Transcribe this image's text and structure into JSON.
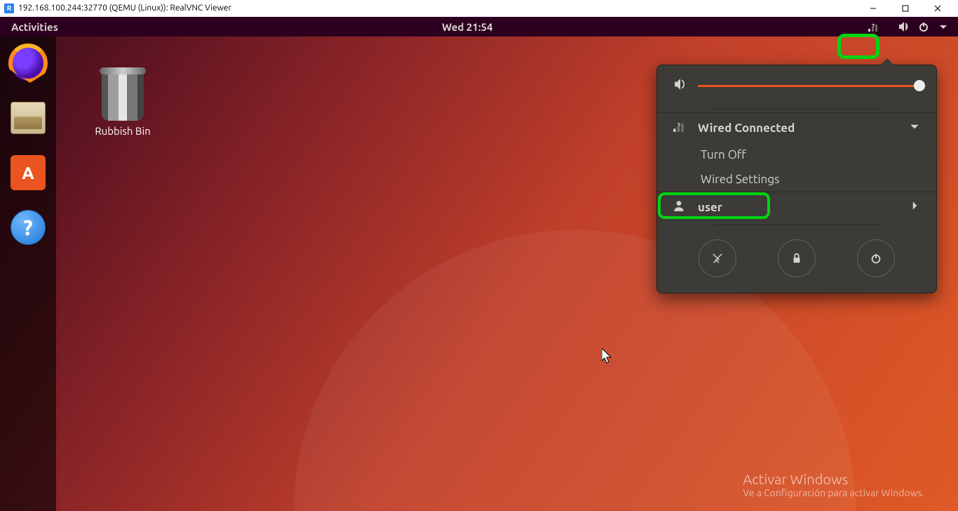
{
  "host": {
    "title": "192.168.100.244:32770 (QEMU (Linux)): RealVNC Viewer"
  },
  "topbar": {
    "activities": "Activities",
    "clock": "Wed 21:54"
  },
  "desktop": {
    "trash_label": "Rubbish Bin"
  },
  "dock": {
    "apps": [
      "firefox",
      "files",
      "software-center",
      "help"
    ]
  },
  "system_menu": {
    "volume_pct": 100,
    "network": {
      "title": "Wired Connected",
      "items": [
        "Turn Off",
        "Wired Settings"
      ]
    },
    "user": {
      "name": "user"
    },
    "actions": [
      "settings",
      "lock",
      "power"
    ]
  },
  "watermark": {
    "line1": "Activar Windows",
    "line2": "Ve a Configuración para activar Windows."
  },
  "highlights": {
    "tray_network_icon": true,
    "wired_settings_item": true
  }
}
